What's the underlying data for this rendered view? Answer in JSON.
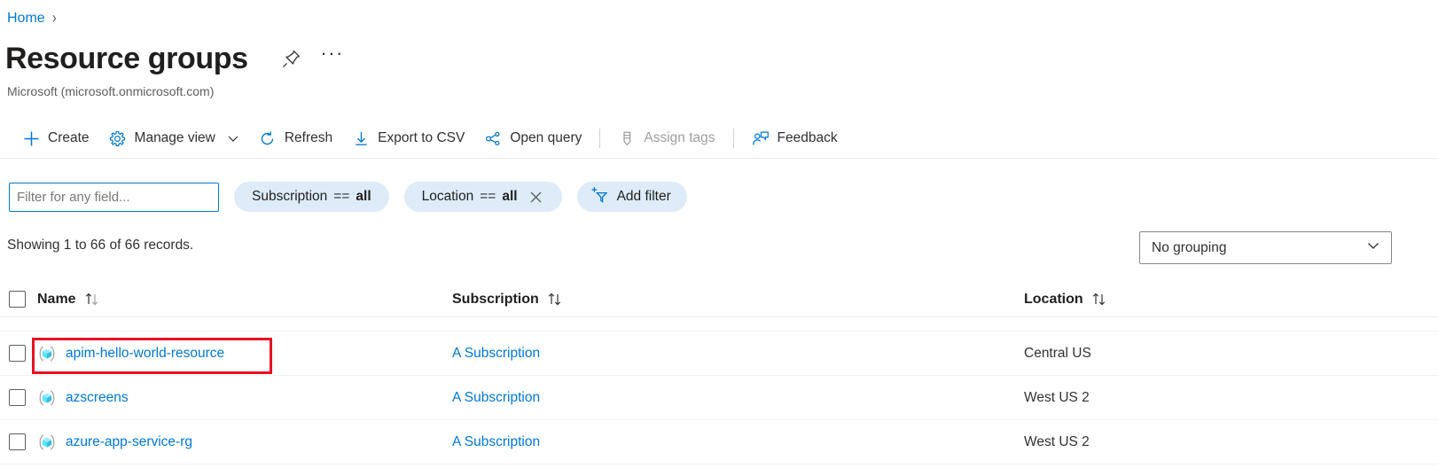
{
  "breadcrumb": {
    "home": "Home",
    "separator": "›"
  },
  "header": {
    "title": "Resource groups",
    "subtitle": "Microsoft (microsoft.onmicrosoft.com)",
    "pin_icon": "pin-icon",
    "more_icon": "ellipsis-icon",
    "more_label": "···"
  },
  "toolbar": {
    "create_label": "Create",
    "manage_view_label": "Manage view",
    "refresh_label": "Refresh",
    "export_csv_label": "Export to CSV",
    "open_query_label": "Open query",
    "assign_tags_label": "Assign tags",
    "assign_tags_disabled": true,
    "feedback_label": "Feedback"
  },
  "filters": {
    "search_placeholder": "Filter for any field...",
    "search_value": "",
    "pills": [
      {
        "field": "Subscription",
        "op": "==",
        "value": "all",
        "removable": false
      },
      {
        "field": "Location",
        "op": "==",
        "value": "all",
        "removable": true
      }
    ],
    "add_filter_label": "Add filter"
  },
  "summary": {
    "records_text": "Showing 1 to 66 of 66 records.",
    "grouping_value": "No grouping"
  },
  "table": {
    "columns": [
      {
        "label": "Name",
        "sortable": true
      },
      {
        "label": "Subscription",
        "sortable": true
      },
      {
        "label": "Location",
        "sortable": true
      }
    ],
    "rows": [
      {
        "name": "",
        "subscription": "",
        "location": "",
        "clipped": true
      },
      {
        "name": "apim-hello-world-resource",
        "subscription": "A Subscription",
        "location": "Central US",
        "highlighted": true
      },
      {
        "name": "azscreens",
        "subscription": "A Subscription",
        "location": "West US 2"
      },
      {
        "name": "azure-app-service-rg",
        "subscription": "A Subscription",
        "location": "West US 2"
      }
    ]
  },
  "colors": {
    "link": "#0078d4",
    "pill_bg": "#deecf9",
    "highlight": "#e81123",
    "resource_icon": "#32bedd"
  }
}
